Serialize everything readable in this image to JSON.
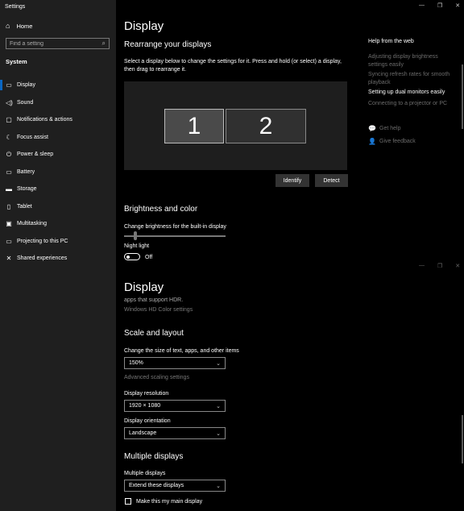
{
  "window": {
    "title": "Settings",
    "controls": [
      "—",
      "❐",
      "✕"
    ]
  },
  "sidebar": {
    "home": "Home",
    "search_placeholder": "Find a setting",
    "section": "System",
    "items": [
      {
        "label": "Display",
        "icon": "monitor-icon",
        "glyph": "▭"
      },
      {
        "label": "Sound",
        "icon": "speaker-icon",
        "glyph": "◁)"
      },
      {
        "label": "Notifications & actions",
        "icon": "notification-icon",
        "glyph": "▢"
      },
      {
        "label": "Focus assist",
        "icon": "moon-icon",
        "glyph": "☾"
      },
      {
        "label": "Power & sleep",
        "icon": "power-icon",
        "glyph": "⏻"
      },
      {
        "label": "Battery",
        "icon": "battery-icon",
        "glyph": "▭"
      },
      {
        "label": "Storage",
        "icon": "storage-icon",
        "glyph": "▬"
      },
      {
        "label": "Tablet",
        "icon": "tablet-icon",
        "glyph": "▯"
      },
      {
        "label": "Multitasking",
        "icon": "multitasking-icon",
        "glyph": "▣"
      },
      {
        "label": "Projecting to this PC",
        "icon": "projecting-icon",
        "glyph": "▭"
      },
      {
        "label": "Shared experiences",
        "icon": "shared-experiences-icon",
        "glyph": "✕"
      }
    ]
  },
  "main": {
    "title": "Display",
    "rearrange": {
      "heading": "Rearrange your displays",
      "description_line1": "Select a display below to change the settings for it. Press and hold (or select) a display,",
      "description_line2": "then drag to rearrange it.",
      "monitor1": "1",
      "monitor2": "2",
      "identify": "Identify",
      "detect": "Detect"
    },
    "brightness": {
      "heading": "Brightness and color",
      "label": "Change brightness for the built-in display",
      "level": 0.1,
      "night_light_label": "Night light",
      "night_light_state": "Off"
    },
    "title2": "Display",
    "hdr_text": "apps that support HDR.",
    "hdr_link": "Windows HD Color settings",
    "scale": {
      "heading": "Scale and layout",
      "size_label": "Change the size of text, apps, and other items",
      "size_value": "150%",
      "advanced_link": "Advanced scaling settings",
      "resolution_label": "Display resolution",
      "resolution_value": "1920 × 1080",
      "orientation_label": "Display orientation",
      "orientation_value": "Landscape"
    },
    "multiple": {
      "heading": "Multiple displays",
      "label": "Multiple displays",
      "value": "Extend these displays",
      "main_display_label": "Make this my main display"
    }
  },
  "help": {
    "title": "Help from the web",
    "links": [
      "Adjusting display brightness settings easily",
      "Syncing refresh rates for smooth playback",
      "Setting up dual monitors easily",
      "Connecting to a projector or PC"
    ],
    "get_help": "Get help",
    "give_feedback": "Give feedback"
  }
}
